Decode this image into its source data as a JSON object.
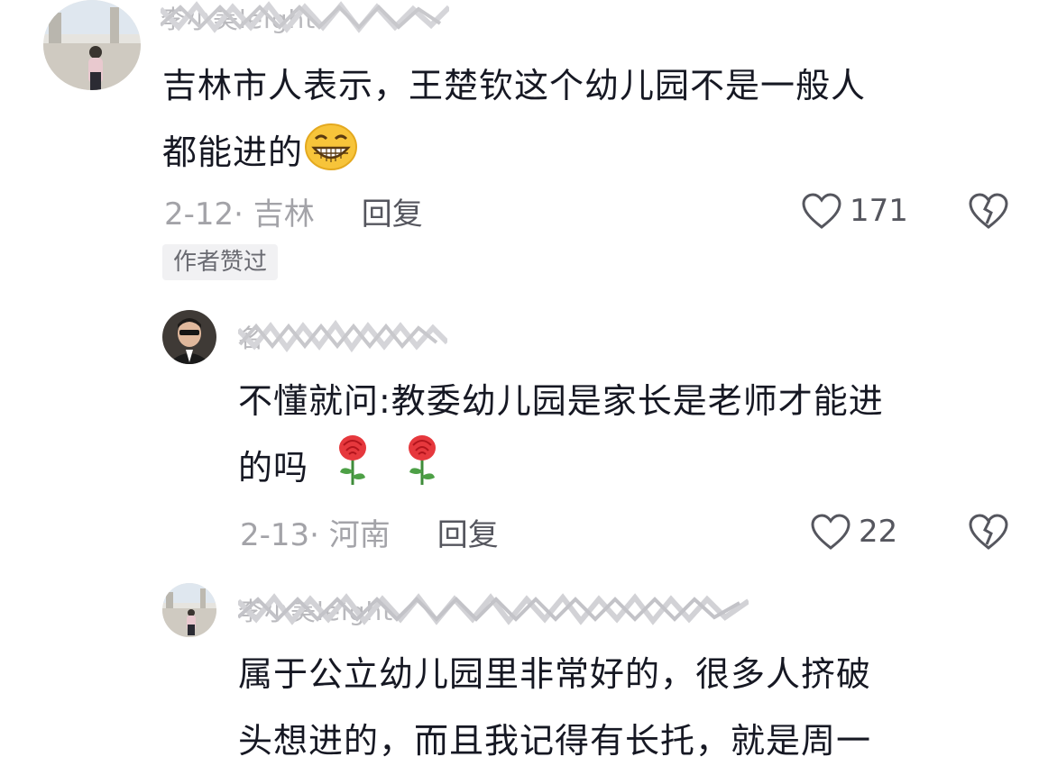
{
  "comments": [
    {
      "username": "李小美leight",
      "text_line1": "吉林市人表示，王楚钦这个幼儿园不是一般人",
      "text_line2": "都能进的",
      "emoji_icon": "grinning-face-icon",
      "date_location": "2-12· 吉林",
      "reply_label": "回复",
      "likes": "171",
      "badge": "作者赞过"
    },
    {
      "username": "名",
      "text_line1": "不懂就问:教委幼儿园是家长是老师才能进",
      "text_line2": "的吗",
      "emoji_icon": "rose-icon",
      "date_location": "2-13· 河南",
      "reply_label": "回复",
      "likes": "22"
    },
    {
      "username": "李小美leight",
      "text_line1": "属于公立幼儿园里非常好的，很多人挤破",
      "text_line2": "头想进的，而且我记得有长托，就是周一"
    }
  ]
}
